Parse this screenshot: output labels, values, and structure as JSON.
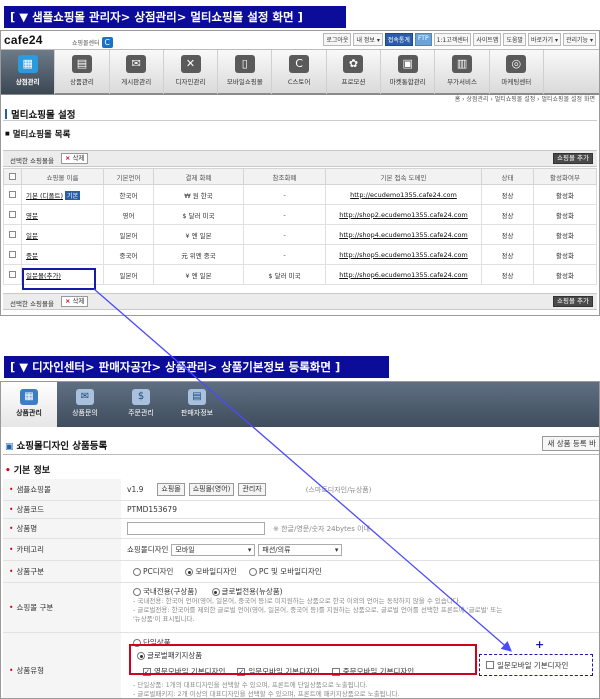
{
  "banners": {
    "admin": "[ ▼ 샘플쇼핑몰 관리자> 상점관리> 멀티쇼핑몰 설정 화면 ]",
    "design": "[ ▼ 디자인센터> 판매자공간> 상품관리> 상품기본정보 등록화면 ]"
  },
  "admin": {
    "logo_text": "cafe24",
    "logo_sub": "쇼핑몰센터",
    "util_links": [
      "로그아웃",
      "내 정보 ▾",
      "접속통계",
      "FTP",
      "1:1고객센터",
      "사이트맵",
      "도움말",
      "바로가기 ▾",
      "관리기능 ▾"
    ],
    "menu": [
      "상점관리",
      "상품관리",
      "게시판관리",
      "디자인관리",
      "모바일쇼핑몰",
      "C스토어",
      "프로모션",
      "마켓통합관리",
      "부가서비스",
      "마케팅센터"
    ],
    "breadcrumb": "홈 › 상점관리 › 멀티쇼핑몰 설정 › 멀티쇼핑몰 설정 화면",
    "page_title": "멀티쇼핑몰 설정",
    "section_title": "멀티쇼핑몰 목록",
    "toolbar_label": "선택한 쇼핑몰을",
    "delete_label": "삭제",
    "add_label": "쇼핑몰 추가",
    "columns": [
      "",
      "쇼핑몰 이름",
      "기본언어",
      "결제 화폐",
      "참조화폐",
      "기본 접속 도메인",
      "상태",
      "활성화여부"
    ],
    "rows": [
      {
        "name": "기본 (디폴트)",
        "tag": "기본",
        "lang": "한국어",
        "currency": "₩ 원 한국",
        "ref": "-",
        "domain": "http://ecudemo1355.cafe24.com",
        "status": "정상",
        "active": "활성화"
      },
      {
        "name": "영문",
        "tag": "",
        "lang": "영어",
        "currency": "$ 달러 미국",
        "ref": "-",
        "domain": "http://shop2.ecudemo1355.cafe24.com",
        "status": "정상",
        "active": "활성화"
      },
      {
        "name": "일문",
        "tag": "",
        "lang": "일본어",
        "currency": "¥ 엔 일본",
        "ref": "-",
        "domain": "http://shop4.ecudemo1355.cafe24.com",
        "status": "정상",
        "active": "활성화"
      },
      {
        "name": "중문",
        "tag": "",
        "lang": "중국어",
        "currency": "元 위엔 중국",
        "ref": "-",
        "domain": "http://shop5.ecudemo1355.cafe24.com",
        "status": "정상",
        "active": "활성화"
      },
      {
        "name": "일문몰(추가)",
        "tag": "",
        "lang": "일본어",
        "currency": "¥ 엔 일본",
        "ref": "$ 달러 미국",
        "domain": "http://shop6.ecudemo1355.cafe24.com",
        "status": "정상",
        "active": "활성화"
      }
    ]
  },
  "design": {
    "tabs": [
      "상품관리",
      "상품문의",
      "주문관리",
      "판매자정보"
    ],
    "page_title": "쇼핑몰디자인 상품등록",
    "new_button": "새 상품 등록 바",
    "section_title": "기본 정보",
    "fields": {
      "mall_label": "샘플쇼핑몰",
      "mall_version": "v1.9",
      "mall_buttons": [
        "쇼핑몰",
        "쇼핑몰(영어)",
        "관리자"
      ],
      "mall_hint": "(스마트디자인/뉴상품)",
      "code_label": "상품코드",
      "code_value": "PTMD153679",
      "name_label": "상품명",
      "name_hint": "※ 한글/영문/숫자 24bytes 이내",
      "category_label": "카테고리",
      "category_prefix": "쇼핑몰디자인",
      "category_sel1": "모바일",
      "category_sel2": "패션/의류",
      "type_label": "상품구분",
      "type_options": [
        "PC디자인",
        "모바일디자인",
        "PC 및 모바일디자인"
      ],
      "mallkind_label": "쇼핑몰 구분",
      "mallkind_options": [
        "국내전용(구상품)",
        "글로벌전용(뉴상품)"
      ],
      "mallkind_notes": [
        "- 국내전용: 한국어 언어(영어, 일본어, 중국어 등)로 미지원하는 상품으로 한국 이외의 언어는 동작하지 않을 수 있습니다.",
        "- 글로벌전용: 한국어를 제외한 글로벌 언어(영어, 일본어, 중국어 등)를 지원하는 상품으로, 글로벌 언어를 선택한 프론트에 '글로벌' 또는",
        "  '뉴상품'이 표시됩니다."
      ],
      "prodtype_label": "상품유형",
      "single_option": "단일상품",
      "package_option": "글로벌패키지상품",
      "package_items": [
        "영문모바일 기본디자인",
        "일문모바일 기본디자인",
        "중문모바일 기본디자인"
      ],
      "extra_item": "일문모바일 기본디자인",
      "plus_sign": "+",
      "prodtype_notes": [
        "- 단일상품: 1개의 대표디자인을 선택할 수 있으며, 프론트에 단일상품으로 노출됩니다.",
        "- 글로벌패키지: 2개 이상의 대표디자인을 선택할 수 있으며, 프론트에 패키지상품으로 노출됩니다."
      ]
    }
  },
  "colors": {
    "banner": "#0c0c9a",
    "highlight_red": "#d0021b",
    "highlight_blue": "#1a1aa8",
    "arrow": "#4a4aff"
  },
  "icons": [
    "shop-settings-icon",
    "product-icon",
    "board-icon",
    "design-tools-icon",
    "mobile-icon",
    "c-store-icon",
    "promotion-icon",
    "market-icon",
    "addon-icon",
    "marketing-icon"
  ]
}
